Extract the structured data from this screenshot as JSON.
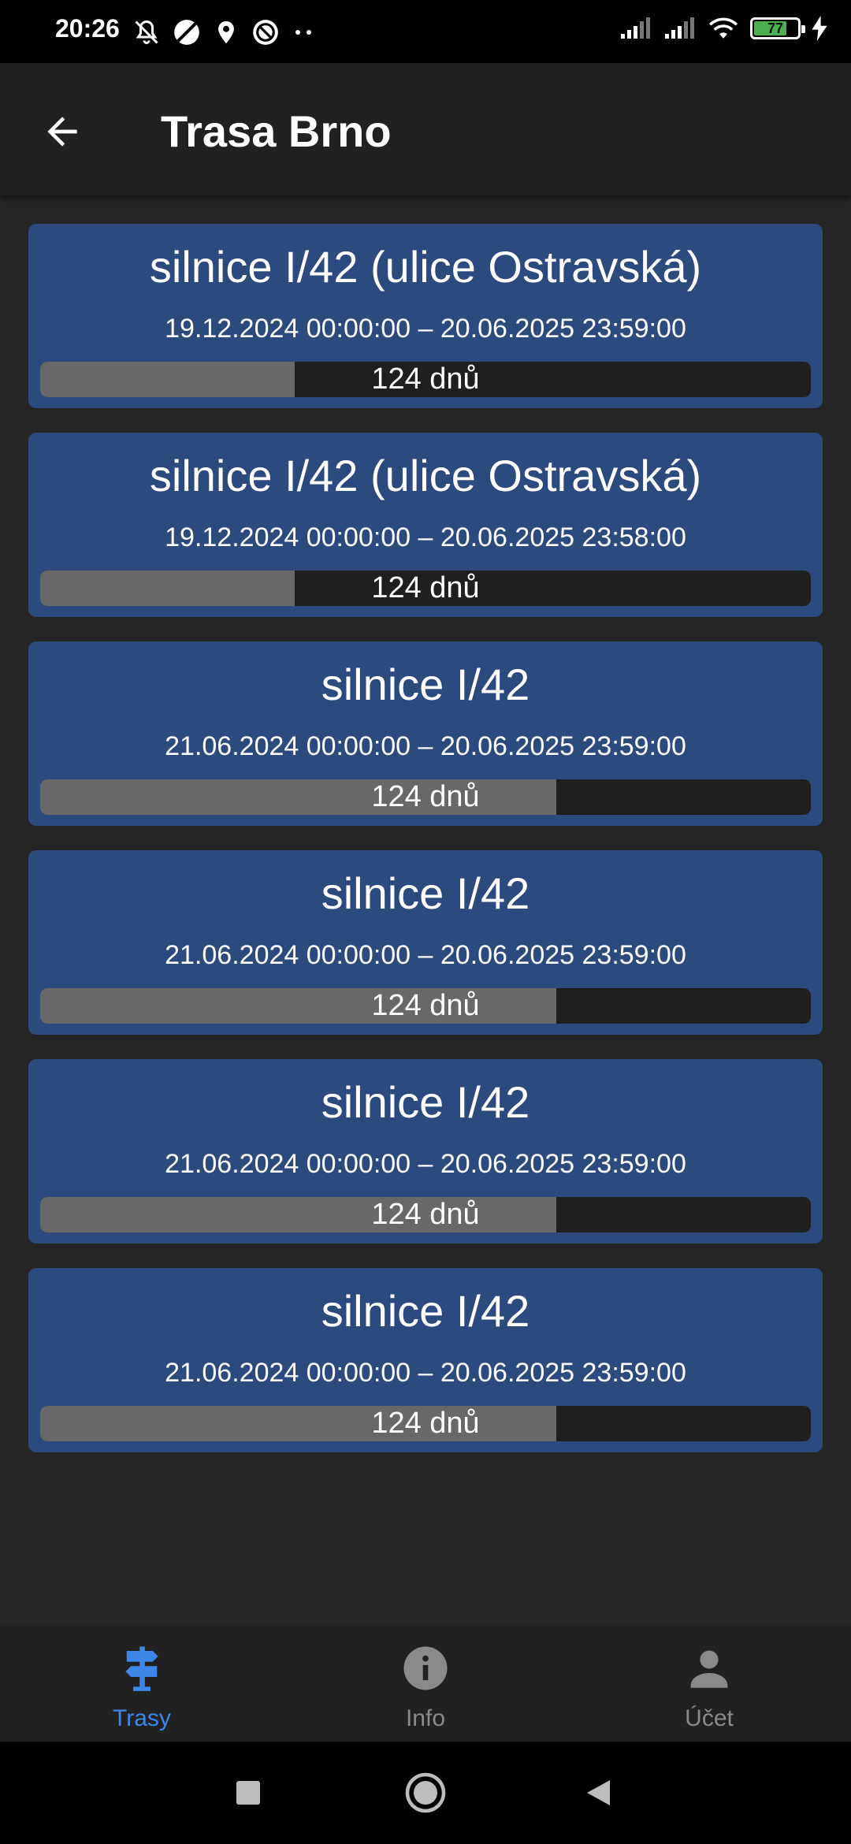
{
  "status_bar": {
    "time": "20:26",
    "battery": "77",
    "battery_level": 0.77,
    "icons_left": [
      "mute-icon",
      "no-sim-icon",
      "location-icon",
      "at-sign-icon",
      "more-dots-icon"
    ],
    "icons_right": [
      "signal-icon",
      "signal-icon",
      "wifi-icon",
      "battery-icon",
      "charging-icon"
    ]
  },
  "app_bar": {
    "back_icon": "arrow-back-icon",
    "title": "Trasa Brno"
  },
  "routes": [
    {
      "title": "silnice I/42 (ulice Ostravská)",
      "dates": "19.12.2024 00:00:00 – 20.06.2025 23:59:00",
      "remaining": "124 dnů",
      "progress": 0.33
    },
    {
      "title": "silnice I/42 (ulice Ostravská)",
      "dates": "19.12.2024 00:00:00 – 20.06.2025 23:58:00",
      "remaining": "124 dnů",
      "progress": 0.33
    },
    {
      "title": "silnice I/42",
      "dates": "21.06.2024 00:00:00 – 20.06.2025 23:59:00",
      "remaining": "124 dnů",
      "progress": 0.67
    },
    {
      "title": "silnice I/42",
      "dates": "21.06.2024 00:00:00 – 20.06.2025 23:59:00",
      "remaining": "124 dnů",
      "progress": 0.67
    },
    {
      "title": "silnice I/42",
      "dates": "21.06.2024 00:00:00 – 20.06.2025 23:59:00",
      "remaining": "124 dnů",
      "progress": 0.67
    },
    {
      "title": "silnice I/42",
      "dates": "21.06.2024 00:00:00 – 20.06.2025 23:59:00",
      "remaining": "124 dnů",
      "progress": 0.67
    }
  ],
  "bottom_nav": {
    "items": [
      {
        "label": "Trasy",
        "icon": "signpost-icon",
        "active": true
      },
      {
        "label": "Info",
        "icon": "info-icon",
        "active": false
      },
      {
        "label": "Účet",
        "icon": "person-icon",
        "active": false
      }
    ]
  },
  "colors": {
    "background": "#252525",
    "card": "#2b4a7e",
    "progress_fill": "#686868",
    "progress_track": "#1f1f1f",
    "accent": "#3d86e8",
    "inactive": "#8a8a8a"
  }
}
